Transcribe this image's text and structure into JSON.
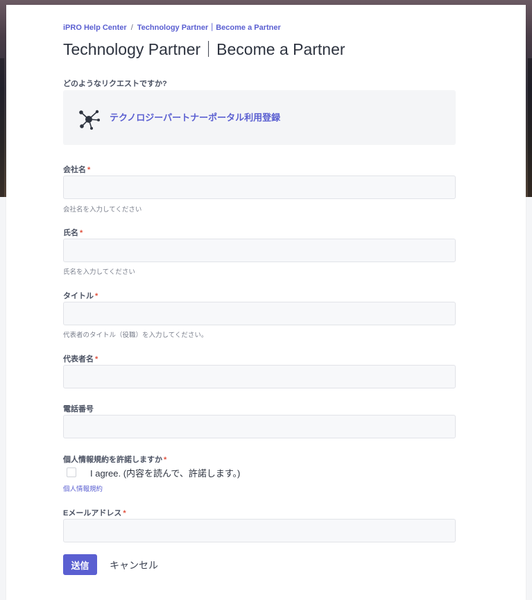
{
  "breadcrumb": {
    "home": "iPRO Help Center",
    "separator": "/",
    "current": "Technology Partner｜Become a Partner"
  },
  "page_title": "Technology Partner｜Become a Partner",
  "request": {
    "question": "どのようなリクエストですか?",
    "selected": "テクノロジーパートナーポータル利用登録",
    "icon": "network-hub-icon"
  },
  "fields": {
    "company": {
      "label": "会社名",
      "required": "*",
      "hint": "会社名を入力してください",
      "value": ""
    },
    "name": {
      "label": "氏名",
      "required": "*",
      "hint": "氏名を入力してください",
      "value": ""
    },
    "title": {
      "label": "タイトル",
      "required": "*",
      "hint": "代表者のタイトル（役職）を入力してください。",
      "value": ""
    },
    "representative": {
      "label": "代表者名",
      "required": "*",
      "value": ""
    },
    "phone": {
      "label": "電話番号",
      "value": ""
    },
    "privacy": {
      "label": "個人情報規約を許諾しますか",
      "required": "*",
      "agree_text": "I agree. (内容を読んで、許諾します。)",
      "link": "個人情報規約"
    },
    "email": {
      "label": "Eメールアドレス",
      "required": "*",
      "value": ""
    }
  },
  "actions": {
    "submit": "送信",
    "cancel": "キャンセル"
  },
  "colors": {
    "accent": "#5a5fd1",
    "required": "#e0523f"
  }
}
